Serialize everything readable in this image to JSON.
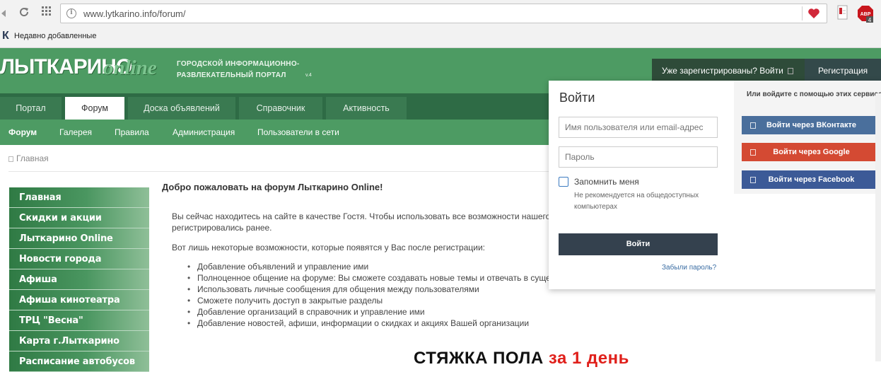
{
  "browser": {
    "url": "www.lytkarino.info/forum/",
    "bookmark_label": "Недавно добавленные",
    "bookmark_icon_letter": "К",
    "ext_abp_label": "ABP",
    "ext_abp_count": "4",
    "icons": [
      "back-icon",
      "reload-icon",
      "apps-icon",
      "site-info-icon",
      "heart-bookmark-icon",
      "pdf-extension-icon",
      "adblock-icon"
    ]
  },
  "header": {
    "logo_main": "ЛЫТКАРИНО",
    "logo_online": "online",
    "tagline_line1": "ГОРОДСКОЙ ИНФОРМАЦИОННО-",
    "tagline_line2": "РАЗВЛЕКАТЕЛЬНЫЙ ПОРТАЛ",
    "version": "v.4",
    "signin_label": "Уже зарегистрированы? Войти",
    "register_label": "Регистрация",
    "colors": {
      "header_green": "#4d9b63",
      "nav_dark": "#2e6b45",
      "signin_bg": "#2e4b39"
    }
  },
  "primary_nav": [
    {
      "label": "Портал"
    },
    {
      "label": "Форум"
    },
    {
      "label": "Доска объявлений"
    },
    {
      "label": "Справочник"
    },
    {
      "label": "Активность"
    }
  ],
  "secondary_nav": [
    {
      "label": "Форум"
    },
    {
      "label": "Галерея"
    },
    {
      "label": "Правила"
    },
    {
      "label": "Администрация"
    },
    {
      "label": "Пользователи в сети"
    }
  ],
  "breadcrumb": {
    "label": "Главная"
  },
  "sidebar": {
    "items": [
      {
        "label": "Главная"
      },
      {
        "label": "Скидки и акции"
      },
      {
        "label": "Лыткарино Online"
      },
      {
        "label": "Новости города"
      },
      {
        "label": "Афиша"
      },
      {
        "label": "Афиша кинотеатра"
      },
      {
        "label": "ТРЦ \"Весна\""
      },
      {
        "label": "Карта г.Лыткарино"
      },
      {
        "label": "Расписание автобусов"
      }
    ]
  },
  "content": {
    "title": "Добро пожаловать на форум Лыткарино Online!",
    "para1_line1": "Вы сейчас находитесь на сайте в качестве Гостя. Чтобы использовать все возможности нашего с",
    "para1_line2": "регистрировались ранее.",
    "para2": "Вот лишь некоторые возможности, которые появятся у Вас после регистрации:",
    "benefits": [
      "Добавление объявлений и управление ими",
      "Полноценное общение на форуме: Вы сможете создавать новые темы и отвечать в сущес",
      "Использовать личные сообщения для общения между пользователями",
      "Сможете получить доступ в закрытые разделы",
      "Добавление организаций в справочник и управление ими",
      "Добавление новостей, афиши, информации о скидках и акциях Вашей организации"
    ],
    "ad_text_black": "СТЯЖКА ПОЛА",
    "ad_text_red": "за 1 день"
  },
  "login": {
    "title": "Войти",
    "username_placeholder": "Имя пользователя или email-адрес",
    "password_placeholder": "Пароль",
    "remember_label": "Запомнить меня",
    "remember_hint": "Не рекомендуется на общедоступных компьютерах",
    "submit_label": "Войти",
    "forgot_label": "Забыли пароль?",
    "social_title": "Или войдите с помощью этих сервисов",
    "social": [
      {
        "label": "Войти через ВКонтакте",
        "color": "#4a6f9c"
      },
      {
        "label": "Войти через Google",
        "color": "#d44a33"
      },
      {
        "label": "Войти через Facebook",
        "color": "#3c5a97"
      }
    ]
  }
}
